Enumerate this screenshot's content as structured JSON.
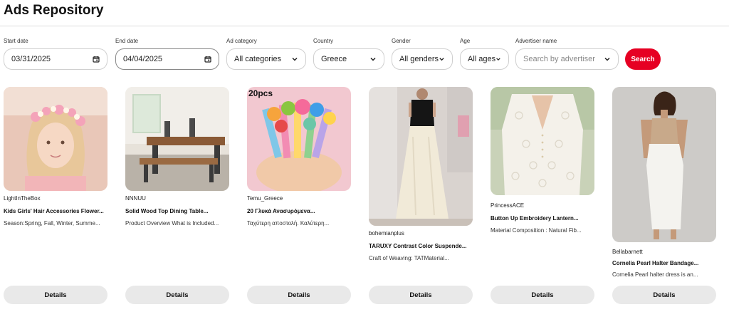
{
  "header": {
    "title": "Ads Repository"
  },
  "filters": {
    "start_date": {
      "label": "Start date",
      "value": "03/31/2025"
    },
    "end_date": {
      "label": "End date",
      "value": "04/04/2025"
    },
    "ad_category": {
      "label": "Ad category",
      "value": "All categories"
    },
    "country": {
      "label": "Country",
      "value": "Greece"
    },
    "gender": {
      "label": "Gender",
      "value": "All genders"
    },
    "age": {
      "label": "Age",
      "value": "All ages"
    },
    "advertiser": {
      "label": "Advertiser name",
      "placeholder": "Search by advertiser"
    },
    "search_label": "Search"
  },
  "accent_color": "#e60023",
  "cards": [
    {
      "advertiser": "LightInTheBox",
      "title": "Kids Girls' Hair Accessories Flower...",
      "desc": "Season:Spring, Fall, Winter, Summe...",
      "details_label": "Details"
    },
    {
      "advertiser": "NNNUU",
      "title": "Solid Wood Top Dining Table...",
      "desc": "Product Overview What is Included...",
      "details_label": "Details"
    },
    {
      "advertiser": "Temu_Greece",
      "title": "20 Γλυκά Ανασυρόμενα...",
      "desc": "Ταχύτερη αποστολή. Καλύτερη...",
      "details_label": "Details",
      "image_text": "20pcs"
    },
    {
      "advertiser": "bohemianplus",
      "title": "TARUXY Contrast Color Suspende...",
      "desc": "Craft of Weaving: TATMaterial...",
      "details_label": "Details"
    },
    {
      "advertiser": "PrincessACE",
      "title": "Button Up Embroidery Lantern...",
      "desc": "Material Composition : Natural Fib...",
      "details_label": "Details"
    },
    {
      "advertiser": "Bellabarnett",
      "title": "Cornelia Pearl Halter Bandage...",
      "desc": "Cornelia Pearl halter dress is an...",
      "details_label": "Details"
    }
  ]
}
